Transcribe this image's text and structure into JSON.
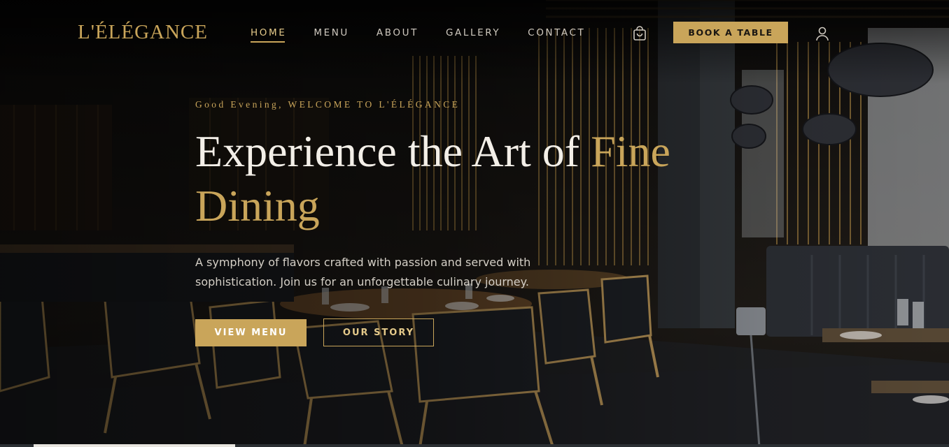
{
  "brand": {
    "name": "L'ÉLÉGANCE"
  },
  "nav": {
    "items": [
      {
        "label": "HOME",
        "active": true
      },
      {
        "label": "MENU",
        "active": false
      },
      {
        "label": "ABOUT",
        "active": false
      },
      {
        "label": "GALLERY",
        "active": false
      },
      {
        "label": "CONTACT",
        "active": false
      }
    ],
    "cart_icon": "shopping-bag-icon",
    "book_label": "BOOK A TABLE",
    "user_icon": "user-icon"
  },
  "hero": {
    "greeting": "Good Evening, WELCOME TO L'ÉLÉGANCE",
    "headline_part1": "Experience the Art of ",
    "headline_highlight": "Fine Dining",
    "subtext": "A symphony of flavors crafted with passion and served with sophistication. Join us for an unforgettable culinary journey.",
    "primary_button": "VIEW MENU",
    "secondary_button": "OUR STORY"
  },
  "colors": {
    "accent_gold": "#c9a55a",
    "text_light": "#f3efe8",
    "background": "#0c0b0a"
  }
}
